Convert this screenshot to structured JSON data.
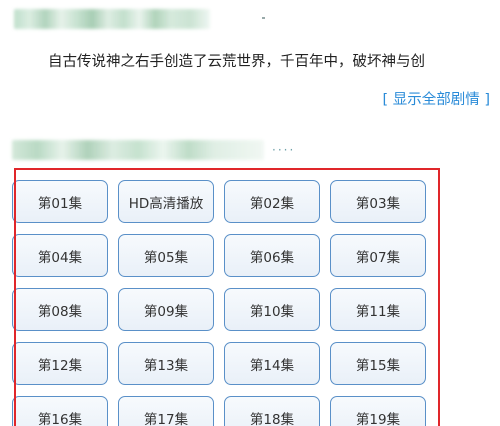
{
  "synopsis": {
    "text": "自古传说神之右手创造了云荒世界，千百年中，破坏神与创",
    "show_all_label": "[ 显示全部剧情 ]"
  },
  "section_dots": "····",
  "episodes": [
    "第01集",
    "HD高清播放",
    "第02集",
    "第03集",
    "第04集",
    "第05集",
    "第06集",
    "第07集",
    "第08集",
    "第09集",
    "第10集",
    "第11集",
    "第12集",
    "第13集",
    "第14集",
    "第15集",
    "第16集",
    "第17集",
    "第18集",
    "第19集"
  ],
  "colors": {
    "highlight_border": "#e0262a",
    "link": "#2a8bd8",
    "button_border": "#5a90c8"
  }
}
